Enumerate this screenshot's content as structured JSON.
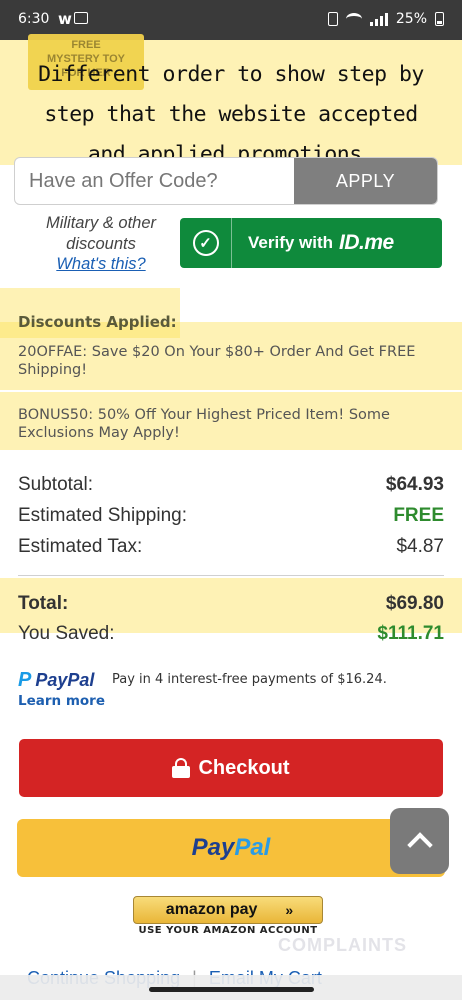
{
  "status_bar": {
    "time": "6:30",
    "app_icon": "w",
    "battery": "25%"
  },
  "promo_badge": {
    "lines": [
      "FREE",
      "MYSTERY TOY",
      "FOR HER"
    ]
  },
  "annotation": {
    "lines": [
      "Different order to show step by",
      "step that the website accepted",
      "and applied promotions."
    ]
  },
  "offer_code": {
    "placeholder": "Have an Offer Code?",
    "value": "",
    "apply_label": "APPLY"
  },
  "military": {
    "text_line1": "Military & other",
    "text_line2": "discounts",
    "link": "What's this?",
    "verify_label": "Verify with",
    "verify_brand": "ID.me",
    "check_icon": "check-circle-icon"
  },
  "discounts": {
    "title": "Discounts Applied:",
    "items": [
      "20OFFAE: Save $20 On Your $80+ Order And Get FREE Shipping!",
      "BONUS50: 50% Off Your Highest Priced Item! Some Exclusions May Apply!"
    ]
  },
  "totals": {
    "subtotal_label": "Subtotal:",
    "subtotal_value": "$64.93",
    "shipping_label": "Estimated Shipping:",
    "shipping_value": "FREE",
    "tax_label": "Estimated Tax:",
    "tax_value": "$4.87",
    "total_label": "Total:",
    "total_value": "$69.80",
    "saved_label": "You Saved:",
    "saved_value": "$111.71"
  },
  "paypal_pay_in_4": {
    "logo_p": "P",
    "logo_text": "PayPal",
    "text": "Pay in 4 interest-free payments of $16.24.",
    "learn_more": "Learn more"
  },
  "checkout": {
    "label": "Checkout",
    "icon": "lock-icon"
  },
  "paypal_button": {
    "pay": "Pay",
    "pal": "Pal"
  },
  "amazon_pay": {
    "label": "amazon pay",
    "chevrons": "»",
    "subtext": "USE YOUR AMAZON ACCOUNT"
  },
  "watermark": "COMPLAINTS",
  "footer": {
    "continue": "Continue Shopping",
    "separator": "|",
    "email": "Email My Cart"
  },
  "colors": {
    "highlight": "#fce25a",
    "checkout_red": "#d42424",
    "idme_green": "#0f8a3c",
    "paypal_yellow": "#f7c03a",
    "free_green": "#2e8b2e"
  }
}
